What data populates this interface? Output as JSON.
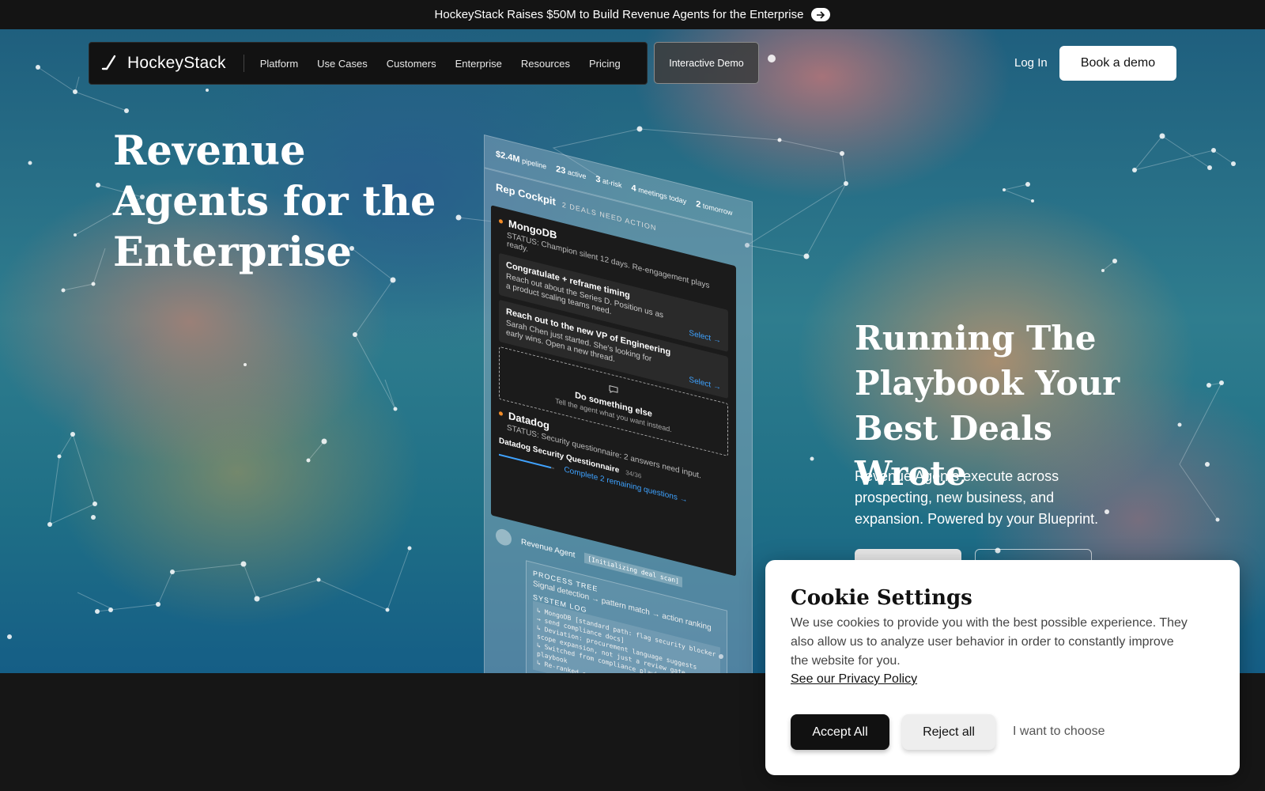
{
  "banner": {
    "text": "HockeyStack Raises $50M to Build Revenue Agents for the Enterprise",
    "icon": "arrow-right-icon"
  },
  "nav": {
    "logo": "HockeyStack",
    "links": [
      "Platform",
      "Use Cases",
      "Customers",
      "Enterprise",
      "Resources",
      "Pricing"
    ],
    "demo": "Interactive Demo",
    "login": "Log In",
    "book": "Book a demo"
  },
  "hero": {
    "title": "Revenue Agents for the Enterprise",
    "right_title": "Running The Playbook Your Best Deals Wrote",
    "right_sub": "Revenue Agents execute across prospecting, new business, and expansion. Powered by your Blueprint."
  },
  "device": {
    "stats": [
      {
        "value": "$2.4M",
        "label": "pipeline"
      },
      {
        "value": "23",
        "label": "active"
      },
      {
        "value": "3",
        "label": "at-risk"
      },
      {
        "value": "4",
        "label": "meetings today"
      },
      {
        "value": "2",
        "label": "tomorrow"
      }
    ],
    "title": "Rep Cockpit",
    "subtitle": "2 DEALS NEED ACTION",
    "deal1": {
      "name": "MongoDB",
      "status": "STATUS: Champion silent 12 days. Re-engagement plays ready.",
      "cards": [
        {
          "title": "Congratulate + reframe timing",
          "desc": "Reach out about the Series D. Position us as a product scaling teams need.",
          "action": "Select →"
        },
        {
          "title": "Reach out to the new VP of Engineering",
          "desc": "Sarah Chen just started. She's looking for early wins. Open a new thread.",
          "action": "Select →"
        }
      ],
      "else_title": "Do something else",
      "else_desc": "Tell the agent what you want instead."
    },
    "deal2": {
      "name": "Datadog",
      "status": "STATUS: Security questionnaire: 2 answers need input.",
      "questionnaire": "Datadog Security Questionnaire",
      "count": "34/36",
      "progress": 0.94,
      "action": "Complete 2 remaining questions →"
    },
    "agent": {
      "name": "Revenue Agent",
      "tag": "[Initializing deal scan]",
      "process_title": "PROCESS TREE",
      "process_desc": "Signal detection → pattern match → action ranking",
      "log_title": "SYSTEM LOG",
      "log": [
        "↳ MongoDB [standard path: flag security blocker → send compliance docs]",
        "↳ Deviation: procurement language suggests scope expansion, not just a review gate",
        "↳ Switched from compliance playbook → expansion playbook",
        "↳ Re-ranked act..."
      ]
    }
  },
  "cookie": {
    "title": "Cookie Settings",
    "text": "We use cookies to provide you with the best possible experience. They also allow us to analyze user behavior in order to constantly improve the website for you.",
    "link": "See our Privacy Policy",
    "accept": "Accept All",
    "reject": "Reject all",
    "choose": "I want to choose"
  }
}
